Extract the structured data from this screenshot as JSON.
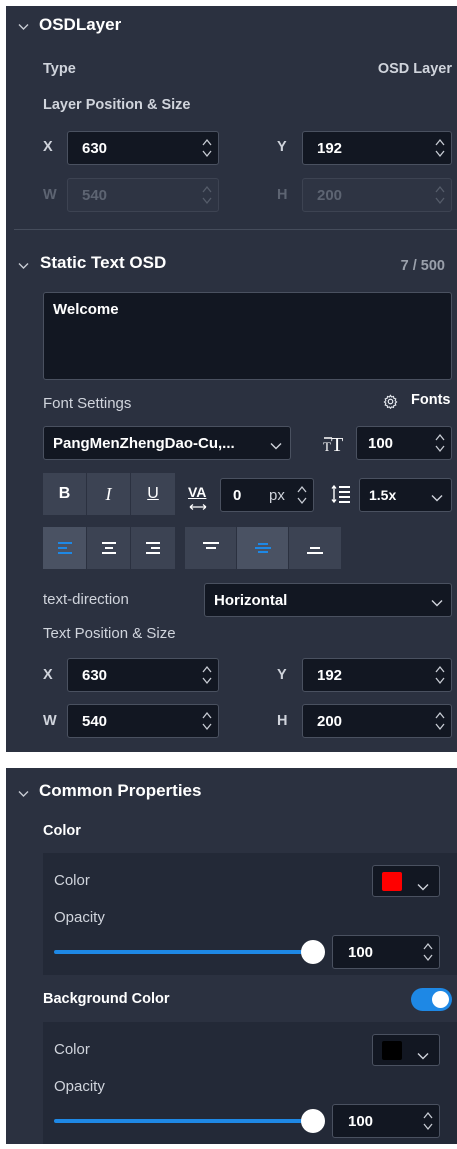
{
  "osd_layer": {
    "title": "OSDLayer",
    "type_label": "Type",
    "type_value": "OSD Layer",
    "position_size_label": "Layer Position & Size",
    "x_label": "X",
    "x_value": "630",
    "y_label": "Y",
    "y_value": "192",
    "w_label": "W",
    "w_value": "540",
    "h_label": "H",
    "h_value": "200"
  },
  "static_text": {
    "title": "Static Text OSD",
    "char_count": "7 / 500",
    "text_value": "Welcome",
    "font_settings_label": "Font Settings",
    "fonts_link": "Fonts",
    "font_family": "PangMenZhengDao-Cu,...",
    "font_size": "100",
    "bold_label": "B",
    "italic_label": "I",
    "underline_label": "U",
    "letter_spacing_icon": "VA",
    "letter_spacing_value": "0",
    "letter_spacing_unit": "px",
    "line_height": "1.5x",
    "text_direction_label": "text-direction",
    "text_direction_value": "Horizontal",
    "text_position_label": "Text Position & Size",
    "x_label": "X",
    "x_value": "630",
    "y_label": "Y",
    "y_value": "192",
    "w_label": "W",
    "w_value": "540",
    "h_label": "H",
    "h_value": "200"
  },
  "common": {
    "title": "Common Properties",
    "color_section_label": "Color",
    "color_label": "Color",
    "color_hex": "#ff0000",
    "opacity_label": "Opacity",
    "opacity_value": "100",
    "bg_section_label": "Background Color",
    "bg_enabled": true,
    "bg_color_label": "Color",
    "bg_color_hex": "#000000",
    "bg_opacity_label": "Opacity",
    "bg_opacity_value": "100"
  },
  "colors": {
    "accent": "#1e88e5",
    "panel": "#2b3140",
    "field": "#121722"
  }
}
